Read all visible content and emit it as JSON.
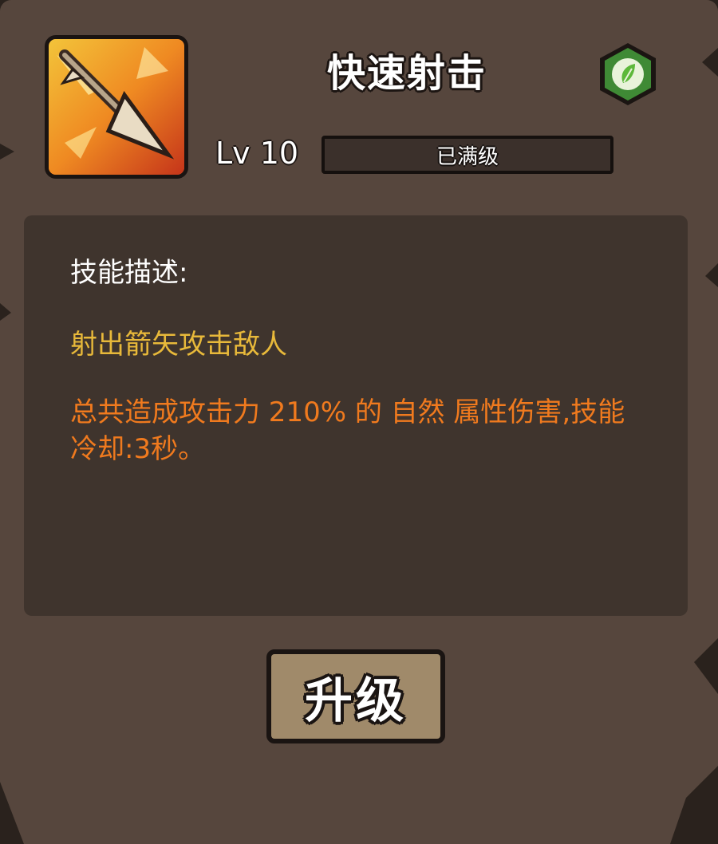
{
  "skill": {
    "title": "快速射击",
    "icon": "arrow-fire-skill-icon",
    "element_icon": "nature-leaf-icon",
    "level_label": "Lv 10",
    "level_status": "已满级"
  },
  "description": {
    "heading": "技能描述:",
    "summary": "射出箭矢攻击敌人",
    "detail": "总共造成攻击力 210% 的 自然 属性伤害,技能冷却:3秒。"
  },
  "actions": {
    "upgrade_label": "升级"
  },
  "colors": {
    "panel": "#56463d",
    "desc_box": "#3f342d",
    "summary_text": "#e8b93a",
    "detail_text": "#f07a1e",
    "element_green": "#5cb83a",
    "button": "#a08a6a"
  }
}
